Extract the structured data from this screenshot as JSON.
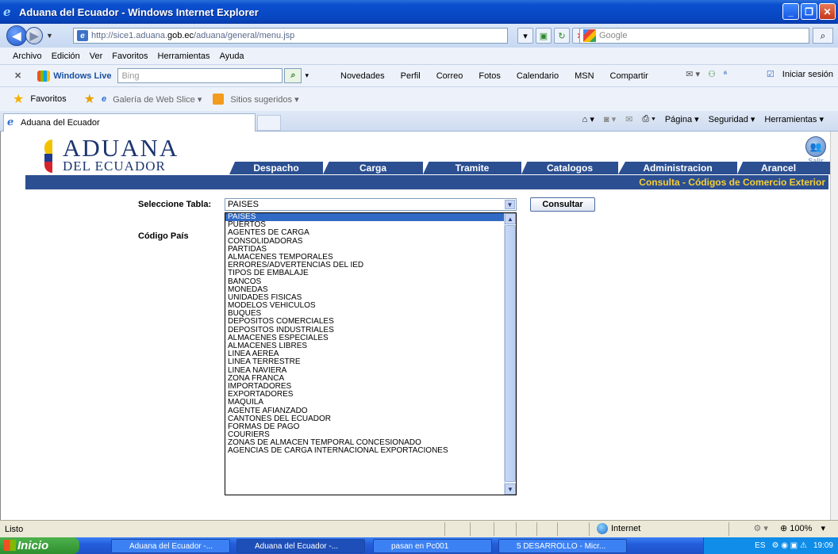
{
  "window": {
    "title": "Aduana del Ecuador - Windows Internet Explorer"
  },
  "address": {
    "url_prefix": "http://sice1.aduana.",
    "url_host": "gob.ec",
    "url_suffix": "/aduana/general/menu.jsp",
    "search_placeholder": "Google"
  },
  "menu": [
    "Archivo",
    "Edición",
    "Ver",
    "Favoritos",
    "Herramientas",
    "Ayuda"
  ],
  "live_toolbar": {
    "brand": "Windows Live",
    "search_placeholder": "Bing",
    "links": [
      "Novedades",
      "Perfil",
      "Correo",
      "Fotos",
      "Calendario",
      "MSN",
      "Compartir"
    ],
    "signin": "Iniciar sesión"
  },
  "favorites": {
    "label": "Favoritos",
    "items": [
      "Galería de Web Slice ▾",
      "Sitios sugeridos ▾"
    ]
  },
  "tabs": {
    "current": "Aduana del Ecuador"
  },
  "commandbar": {
    "items": [
      "Página ▾",
      "Seguridad ▾",
      "Herramientas ▾"
    ]
  },
  "site": {
    "logo_top": "ADUANA",
    "logo_bottom": "DEL ECUADOR",
    "salir": "Salir",
    "nav": [
      "Despacho",
      "Carga",
      "Tramite",
      "Catalogos",
      "Administracion",
      "Arancel"
    ],
    "section_title": "Consulta - Códigos de Comercio Exterior"
  },
  "form": {
    "label_tabla": "Seleccione Tabla:",
    "label_codigo": "Código País",
    "selected": "PAISES",
    "button": "Consultar",
    "options": [
      "PAISES",
      "PUERTOS",
      "AGENTES DE CARGA",
      "CONSOLIDADORAS",
      "PARTIDAS",
      "ALMACENES TEMPORALES",
      "ERRORES/ADVERTENCIAS DEL IED",
      "TIPOS DE EMBALAJE",
      "BANCOS",
      "MONEDAS",
      "UNIDADES FISICAS",
      "MODELOS VEHICULOS",
      "BUQUES",
      "DEPOSITOS COMERCIALES",
      "DEPOSITOS INDUSTRIALES",
      "ALMACENES ESPECIALES",
      "ALMACENES LIBRES",
      "LINEA AEREA",
      "LINEA TERRESTRE",
      "LINEA NAVIERA",
      "ZONA FRANCA",
      "IMPORTADORES",
      "EXPORTADORES",
      "MAQUILA",
      "AGENTE AFIANZADO",
      "CANTONES DEL ECUADOR",
      "FORMAS DE PAGO",
      "COURIERS",
      "ZONAS DE ALMACEN TEMPORAL CONCESIONADO",
      "AGENCIAS DE CARGA INTERNACIONAL EXPORTACIONES"
    ]
  },
  "status": {
    "text": "Listo",
    "zone": "Internet",
    "zoom": "100%"
  },
  "taskbar": {
    "start": "Inicio",
    "tasks": [
      "Aduana del Ecuador -...",
      "Aduana del Ecuador -...",
      "pasan en Pc001",
      "5 DESARROLLO - Micr..."
    ],
    "lang": "ES",
    "clock": "19:09"
  }
}
